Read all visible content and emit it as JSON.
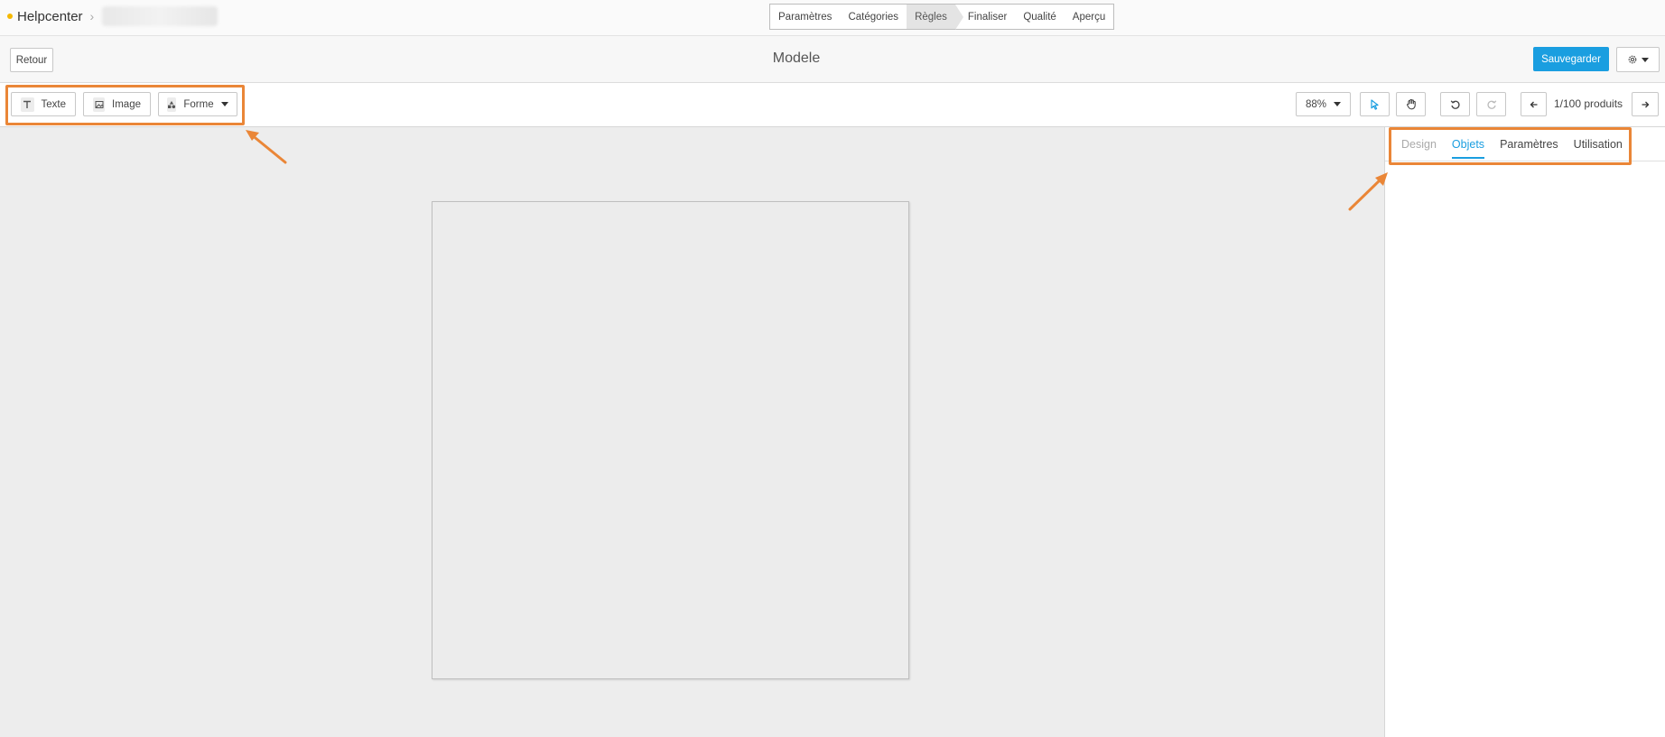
{
  "brand": {
    "name": "Helpcenter"
  },
  "stepper": [
    {
      "label": "Paramètres",
      "active": false
    },
    {
      "label": "Catégories",
      "active": false
    },
    {
      "label": "Règles",
      "active": true
    },
    {
      "label": "Finaliser",
      "active": false
    },
    {
      "label": "Qualité",
      "active": false
    },
    {
      "label": "Aperçu",
      "active": false
    }
  ],
  "header": {
    "back_label": "Retour",
    "title": "Modele",
    "save_label": "Sauvegarder"
  },
  "toolbar": {
    "texte_label": "Texte",
    "image_label": "Image",
    "forme_label": "Forme",
    "zoom": "88%",
    "product_position": "1/100 produits"
  },
  "panel": {
    "tabs": [
      {
        "label": "Design",
        "state": "disabled"
      },
      {
        "label": "Objets",
        "state": "active"
      },
      {
        "label": "Paramètres",
        "state": "normal"
      },
      {
        "label": "Utilisation",
        "state": "normal"
      }
    ]
  },
  "colors": {
    "accent": "#1a9ee0",
    "highlight": "#ea8637",
    "brand_dot": "#f5b800"
  }
}
